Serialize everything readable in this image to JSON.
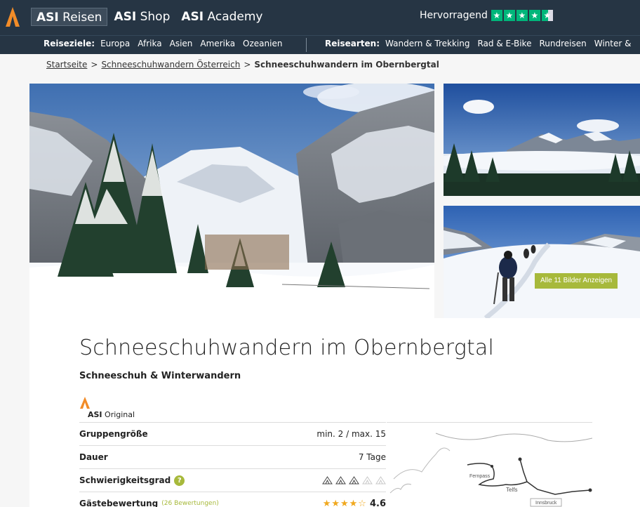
{
  "header": {
    "tabs": [
      {
        "brand": "ASI",
        "label": "Reisen"
      },
      {
        "brand": "ASI",
        "label": "Shop"
      },
      {
        "brand": "ASI",
        "label": "Academy"
      }
    ],
    "trust_label": "Hervorragend",
    "trust_rating_stars": 4.5
  },
  "nav": {
    "destinations_label": "Reiseziele:",
    "destinations": [
      "Europa",
      "Afrika",
      "Asien",
      "Amerika",
      "Ozeanien"
    ],
    "types_label": "Reisearten:",
    "types": [
      "Wandern & Trekking",
      "Rad & E-Bike",
      "Rundreisen",
      "Winter &"
    ]
  },
  "breadcrumb": {
    "items": [
      "Startseite",
      "Schneeschuhwandern Österreich"
    ],
    "current": "Schneeschuhwandern im Obernbergtal",
    "separator": ">"
  },
  "gallery": {
    "button_label": "Alle 11 Bilder Anzeigen"
  },
  "product": {
    "title": "Schneeschuhwandern im Obernbergtal",
    "subtitle": "Schneeschuh & Winterwandern",
    "badge_brand": "ASI",
    "badge_label": "Original",
    "facts": [
      {
        "key": "Gruppengröße",
        "value": "min. 2 / max. 15"
      },
      {
        "key": "Dauer",
        "value": "7 Tage"
      },
      {
        "key": "Schwierigkeitsgrad",
        "difficulty_level": 3,
        "difficulty_max": 5
      },
      {
        "key": "Gästebewertung",
        "reviews": "(26 Bewertungen)",
        "rating": "4.6"
      }
    ]
  },
  "map": {
    "labels": [
      "Fernpass",
      "Telfs",
      "Innsbruck"
    ]
  },
  "colors": {
    "header_bg": "#263544",
    "accent_green": "#a7b93b",
    "logo_orange": "#f28c28",
    "trustpilot_green": "#00b67a",
    "star_orange": "#f0a81e"
  }
}
